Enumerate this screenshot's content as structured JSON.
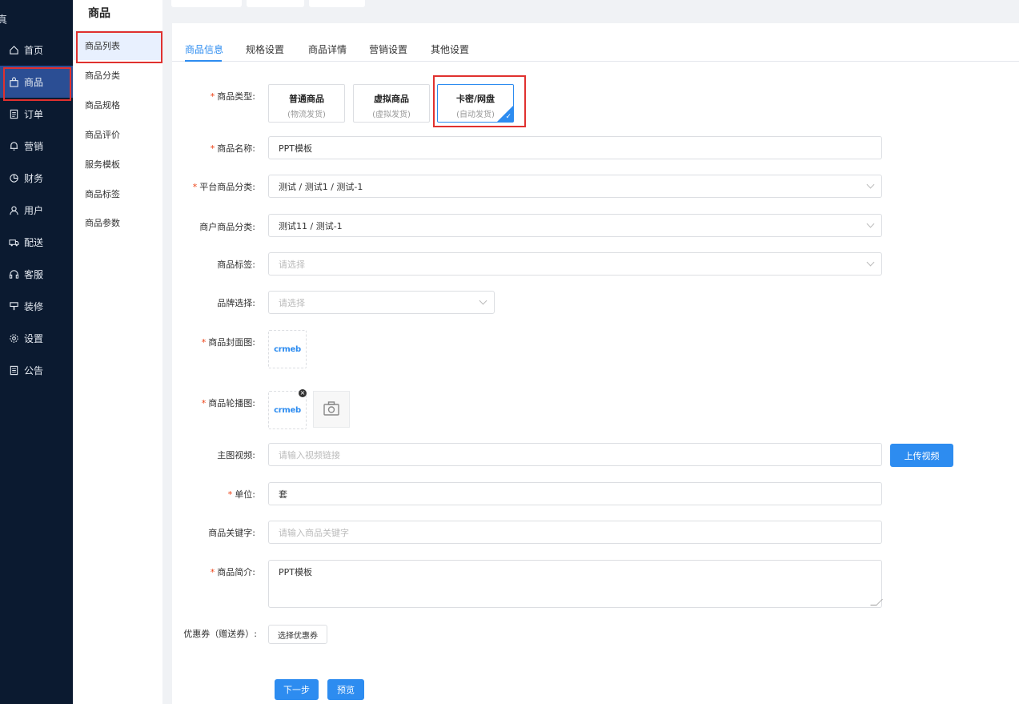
{
  "sidebar": {
    "brand_stub": "真",
    "items": [
      {
        "label": "首页",
        "icon": "home-icon"
      },
      {
        "label": "商品",
        "icon": "bag-icon"
      },
      {
        "label": "订单",
        "icon": "document-icon"
      },
      {
        "label": "营销",
        "icon": "bell-icon"
      },
      {
        "label": "财务",
        "icon": "pie-icon"
      },
      {
        "label": "用户",
        "icon": "user-icon"
      },
      {
        "label": "配送",
        "icon": "truck-icon"
      },
      {
        "label": "客服",
        "icon": "headset-icon"
      },
      {
        "label": "装修",
        "icon": "brush-icon"
      },
      {
        "label": "设置",
        "icon": "gear-icon"
      },
      {
        "label": "公告",
        "icon": "notice-icon"
      }
    ],
    "active_index": 1,
    "colors": {
      "bg": "#0b1a30",
      "active": "#2b4e94",
      "highlight": "#e0312f"
    }
  },
  "subbar": {
    "title": "商品",
    "items": [
      "商品列表",
      "商品分类",
      "商品规格",
      "商品评价",
      "服务模板",
      "商品标签",
      "商品参数"
    ],
    "active_index": 0
  },
  "tabs": {
    "items": [
      "商品信息",
      "规格设置",
      "商品详情",
      "营销设置",
      "其他设置"
    ],
    "active_index": 0
  },
  "form": {
    "type_label": "商品类型:",
    "types": [
      {
        "title": "普通商品",
        "sub": "(物流发货)"
      },
      {
        "title": "虚拟商品",
        "sub": "(虚拟发货)"
      },
      {
        "title": "卡密/网盘",
        "sub": "(自动发货)"
      }
    ],
    "selected_type": 2,
    "name_label": "商品名称:",
    "name_value": "PPT模板",
    "platform_cat_label": "平台商品分类:",
    "platform_cat_value": "测试 / 测试1 / 测试-1",
    "merchant_cat_label": "商户商品分类:",
    "merchant_cat_value": "测试11 / 测试-1",
    "tag_label": "商品标签:",
    "tag_placeholder": "请选择",
    "brand_label": "品牌选择:",
    "brand_placeholder": "请选择",
    "cover_label": "商品封面图:",
    "cover_logo": "crmeb",
    "carousel_label": "商品轮播图:",
    "carousel_logo": "crmeb",
    "video_label": "主图视频:",
    "video_placeholder": "请输入视频链接",
    "upload_video_button": "上传视频",
    "unit_label": "单位:",
    "unit_value": "套",
    "keyword_label": "商品关键字:",
    "keyword_placeholder": "请输入商品关键字",
    "intro_label": "商品简介:",
    "intro_value": "PPT模板",
    "coupon_label": "优惠券（赠送券）:",
    "coupon_button": "选择优惠券",
    "next_button": "下一步",
    "preview_button": "预览",
    "required_mark": "*"
  },
  "accent_color": "#2d8cf0"
}
